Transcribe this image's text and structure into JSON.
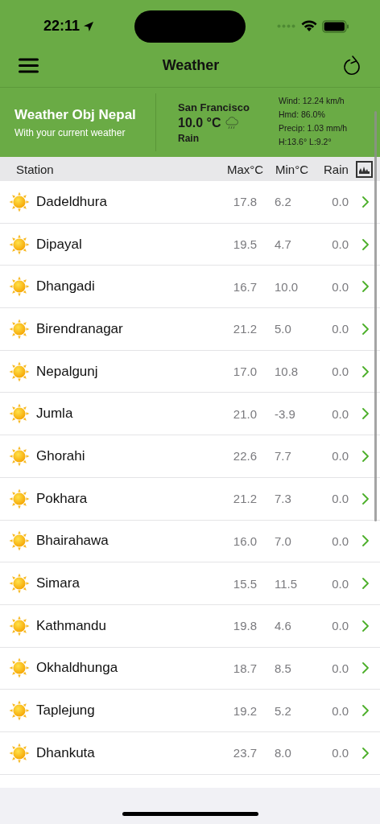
{
  "status_bar": {
    "time": "22:11"
  },
  "nav": {
    "title": "Weather"
  },
  "header": {
    "title": "Weather Obj Nepal",
    "subtitle": "With your current weather",
    "city": "San Francisco",
    "temperature": "10.0 °C",
    "condition": "Rain",
    "details": [
      "Wind: 12.24 km/h",
      "Hmd: 86.0%",
      "Precip: 1.03 mm/h",
      "H:13.6° L:9.2°"
    ]
  },
  "table": {
    "columns": [
      "Station",
      "Max°C",
      "Min°C",
      "Rain"
    ],
    "rows": [
      {
        "station": "Dadeldhura",
        "max": "17.8",
        "min": "6.2",
        "rain": "0.0"
      },
      {
        "station": "Dipayal",
        "max": "19.5",
        "min": "4.7",
        "rain": "0.0"
      },
      {
        "station": "Dhangadi",
        "max": "16.7",
        "min": "10.0",
        "rain": "0.0"
      },
      {
        "station": "Birendranagar",
        "max": "21.2",
        "min": "5.0",
        "rain": "0.0"
      },
      {
        "station": "Nepalgunj",
        "max": "17.0",
        "min": "10.8",
        "rain": "0.0"
      },
      {
        "station": "Jumla",
        "max": "21.0",
        "min": "-3.9",
        "rain": "0.0"
      },
      {
        "station": "Ghorahi",
        "max": "22.6",
        "min": "7.7",
        "rain": "0.0"
      },
      {
        "station": "Pokhara",
        "max": "21.2",
        "min": "7.3",
        "rain": "0.0"
      },
      {
        "station": "Bhairahawa",
        "max": "16.0",
        "min": "7.0",
        "rain": "0.0"
      },
      {
        "station": "Simara",
        "max": "15.5",
        "min": "11.5",
        "rain": "0.0"
      },
      {
        "station": "Kathmandu",
        "max": "19.8",
        "min": "4.6",
        "rain": "0.0"
      },
      {
        "station": "Okhaldhunga",
        "max": "18.7",
        "min": "8.5",
        "rain": "0.0"
      },
      {
        "station": "Taplejung",
        "max": "19.2",
        "min": "5.2",
        "rain": "0.0"
      },
      {
        "station": "Dhankuta",
        "max": "23.7",
        "min": "8.0",
        "rain": "0.0"
      }
    ]
  }
}
